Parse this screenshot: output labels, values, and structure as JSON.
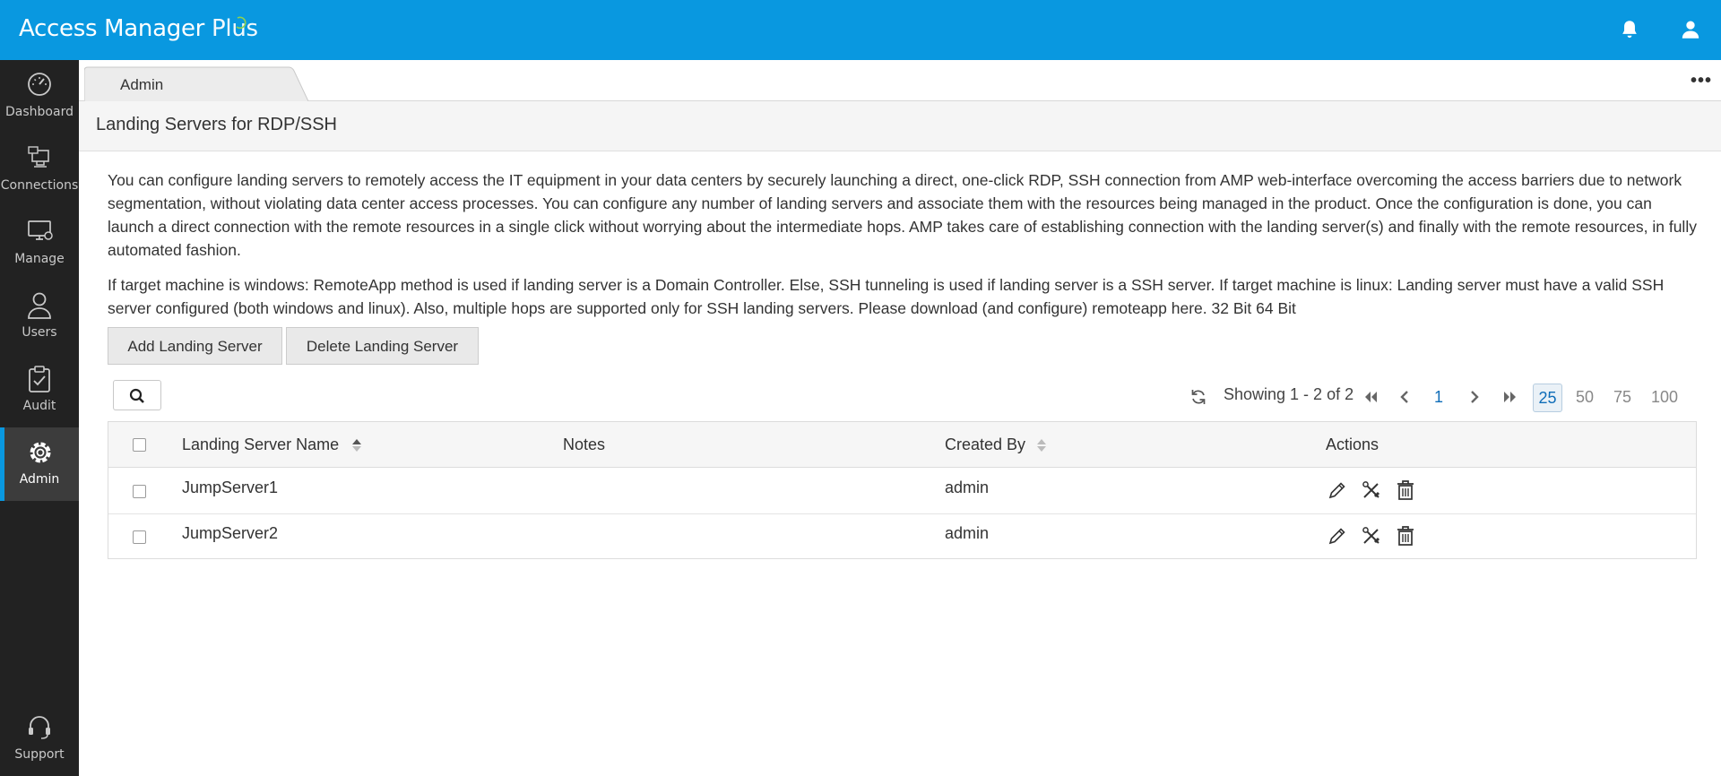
{
  "app": {
    "brand_main": "Access Manager ",
    "brand_plus": "Plus"
  },
  "sidebar": {
    "items": [
      {
        "label": "Dashboard",
        "icon": "dashboard-icon"
      },
      {
        "label": "Connections",
        "icon": "connections-icon"
      },
      {
        "label": "Manage",
        "icon": "manage-icon"
      },
      {
        "label": "Users",
        "icon": "users-icon"
      },
      {
        "label": "Audit",
        "icon": "audit-icon"
      },
      {
        "label": "Admin",
        "icon": "gear-icon",
        "active": true
      }
    ],
    "support_label": "Support"
  },
  "tabs": [
    {
      "label": "Admin"
    }
  ],
  "page": {
    "title": "Landing Servers for RDP/SSH",
    "description": "You can configure landing servers to remotely access the IT equipment in your data centers by securely launching a direct, one-click RDP, SSH connection from AMP web-interface overcoming the access barriers due to network segmentation, without violating data center access processes. You can configure any number of landing servers and associate them with the resources being managed in the product. Once the configuration is done, you can launch a direct connection with the remote resources in a single click without worrying about the intermediate hops. AMP takes care of establishing connection with the landing server(s) and finally with the remote resources, in fully automated fashion.",
    "note": "If target machine is windows: RemoteApp method is used if landing server is a Domain Controller. Else, SSH tunneling is used if landing server is a SSH server. If target machine is linux: Landing server must have a valid SSH server configured (both windows and linux). Also, multiple hops are supported only for SSH landing servers. Please download (and configure) remoteapp here. 32 Bit  64 Bit"
  },
  "toolbar": {
    "add_label": "Add Landing Server",
    "delete_label": "Delete Landing Server"
  },
  "pagination": {
    "showing": "Showing 1 - 2 of 2",
    "page": "1",
    "page_sizes": [
      "25",
      "50",
      "75",
      "100"
    ],
    "selected_size": "25"
  },
  "table": {
    "columns": [
      "Landing Server Name",
      "Notes",
      "Created By",
      "Actions"
    ],
    "rows": [
      {
        "name": "JumpServer1",
        "notes": "",
        "created_by": "admin"
      },
      {
        "name": "JumpServer2",
        "notes": "",
        "created_by": "admin"
      }
    ]
  },
  "colors": {
    "accent": "#0998e0",
    "sidebar_bg": "#222222",
    "active_nav_bg": "#3c3c3c"
  }
}
